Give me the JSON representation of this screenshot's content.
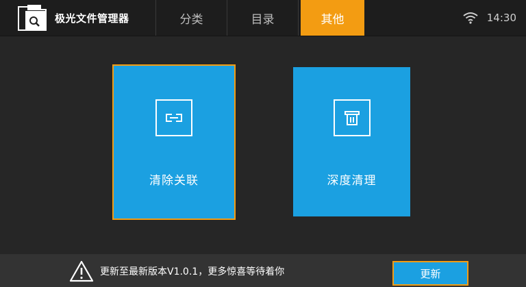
{
  "header": {
    "app_title": "极光文件管理器",
    "tabs": [
      {
        "label": "分类",
        "active": false
      },
      {
        "label": "目录",
        "active": false
      },
      {
        "label": "其他",
        "active": true
      }
    ],
    "status": {
      "time": "14:30",
      "wifi_icon": "wifi-icon"
    },
    "brand_icon": "folder-search-icon"
  },
  "tiles": [
    {
      "label": "清除关联",
      "icon": "link-icon",
      "selected": true
    },
    {
      "label": "深度清理",
      "icon": "trash-icon",
      "selected": false
    }
  ],
  "footer": {
    "notice": "更新至最新版本V1.0.1，更多惊喜等待着你",
    "update_button": "更新",
    "warning_icon": "warning-icon"
  },
  "colors": {
    "accent": "#f39c12",
    "tile": "#1ba0e1",
    "background": "#262626",
    "topbar": "#1d1d1d",
    "bottombar": "#333333"
  }
}
